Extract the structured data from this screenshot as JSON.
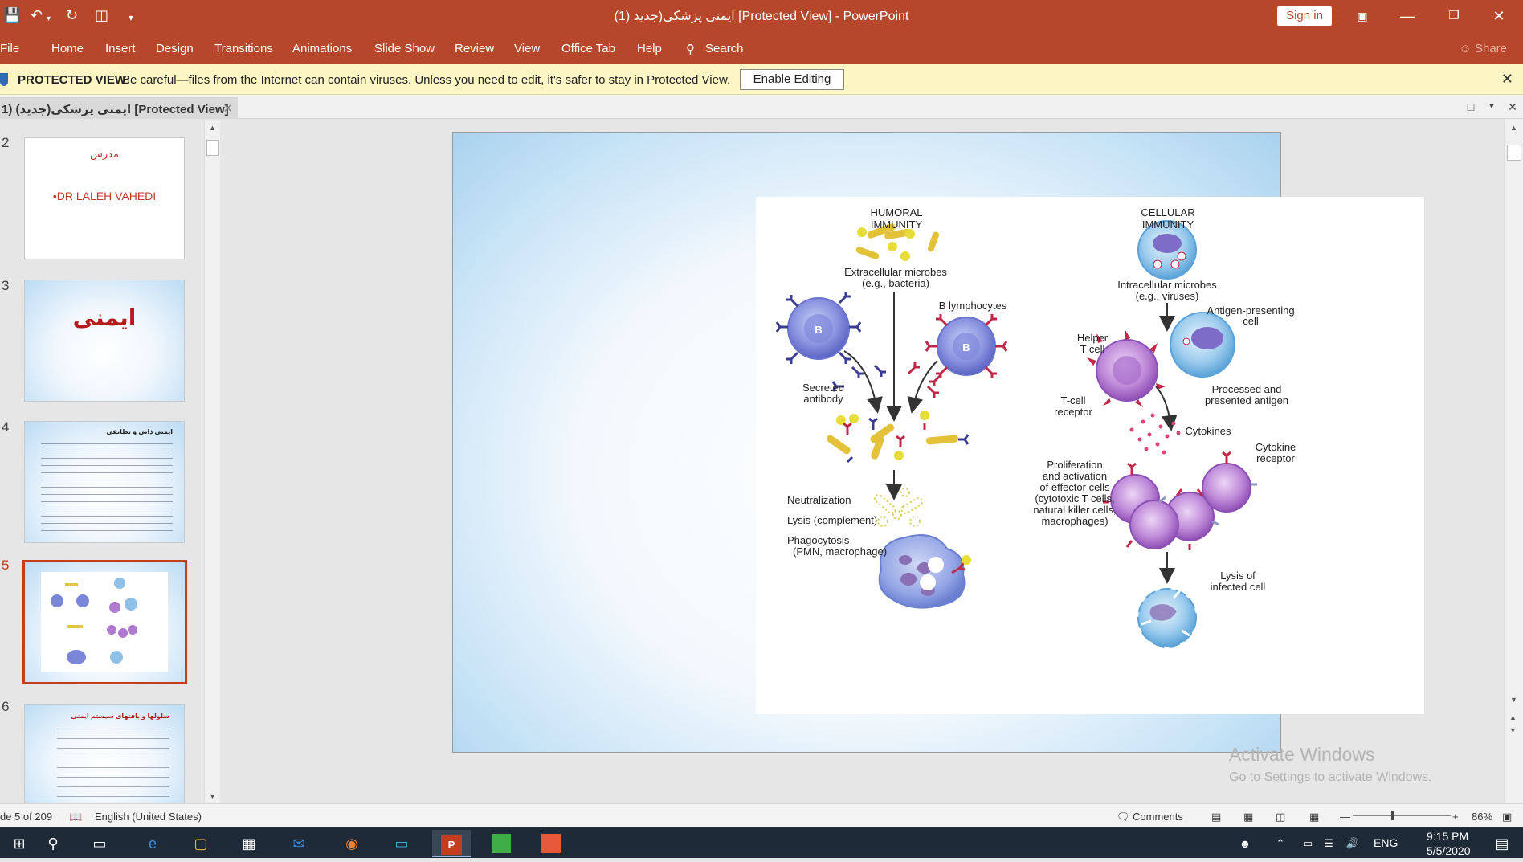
{
  "titlebar": {
    "title": "ایمنی پزشکی(جدید (1) [Protected View]  -  PowerPoint",
    "signin_label": "Sign in"
  },
  "ribbon": {
    "tabs": [
      "File",
      "Home",
      "Insert",
      "Design",
      "Transitions",
      "Animations",
      "Slide Show",
      "Review",
      "View",
      "Office Tab",
      "Help"
    ],
    "search_label": "Search",
    "share_label": "Share"
  },
  "protected_view": {
    "label": "PROTECTED VIEW",
    "message": "Be careful—files from the Internet can contain viruses. Unless you need to edit, it's safer to stay in Protected View.",
    "button_label": "Enable Editing"
  },
  "doc_tab": {
    "label": "1) ایمنی پزشکی(جدید) [Protected View]"
  },
  "thumbnails": [
    {
      "number": "2",
      "line1": "مدرس",
      "line2": "•DR LALEH VAHEDI"
    },
    {
      "number": "3",
      "title": "ایمنی"
    },
    {
      "number": "4",
      "title": "ایمنی ذاتی و تطابقی"
    },
    {
      "number": "5"
    },
    {
      "number": "6",
      "title": "سلولها و بافتهای سیستم ایمنی"
    }
  ],
  "figure": {
    "humoral_title": "HUMORAL IMMUNITY",
    "cellular_title": "CELLULAR IMMUNITY",
    "extracellular": "Extracellular microbes",
    "extracellular_eg": "(e.g., bacteria)",
    "b_lymphocytes": "B lymphocytes",
    "b_label": "B",
    "secreted": "Secreted",
    "antibody": "antibody",
    "neutralization": "Neutralization",
    "lysis_complement": "Lysis (complement)",
    "phagocytosis": "Phagocytosis",
    "phagocytosis_sub": "(PMN, macrophage)",
    "intracellular": "Intracellular microbes",
    "intracellular_eg": "(e.g., viruses)",
    "apc1": "Antigen-presenting",
    "apc2": "cell",
    "helper1": "Helper",
    "helper2": "T cell",
    "tcr1": "T-cell",
    "tcr2": "receptor",
    "processed1": "Processed and",
    "processed2": "presented antigen",
    "cytokines": "Cytokines",
    "cytokine_receptor1": "Cytokine",
    "cytokine_receptor2": "receptor",
    "prolif1": "Proliferation",
    "prolif2": "and activation",
    "prolif3": "of effector cells",
    "prolif4": "(cytotoxic T cells,",
    "prolif5": "natural killer cells,",
    "prolif6": "macrophages)",
    "lysis_infected1": "Lysis of",
    "lysis_infected2": "infected cell"
  },
  "watermark": {
    "line1": "Activate Windows",
    "line2": "Go to Settings to activate Windows."
  },
  "status": {
    "slide_count": "de 5 of 209",
    "language": "English (United States)",
    "comments": "Comments",
    "zoom": "86%"
  },
  "taskbar": {
    "language": "ENG",
    "time": "9:15 PM",
    "date": "5/5/2020"
  },
  "colors": {
    "accent": "#b7472a",
    "selection": "#c43e1c",
    "b_cell": "#7a86d8",
    "t_cell": "#b07ad0"
  }
}
